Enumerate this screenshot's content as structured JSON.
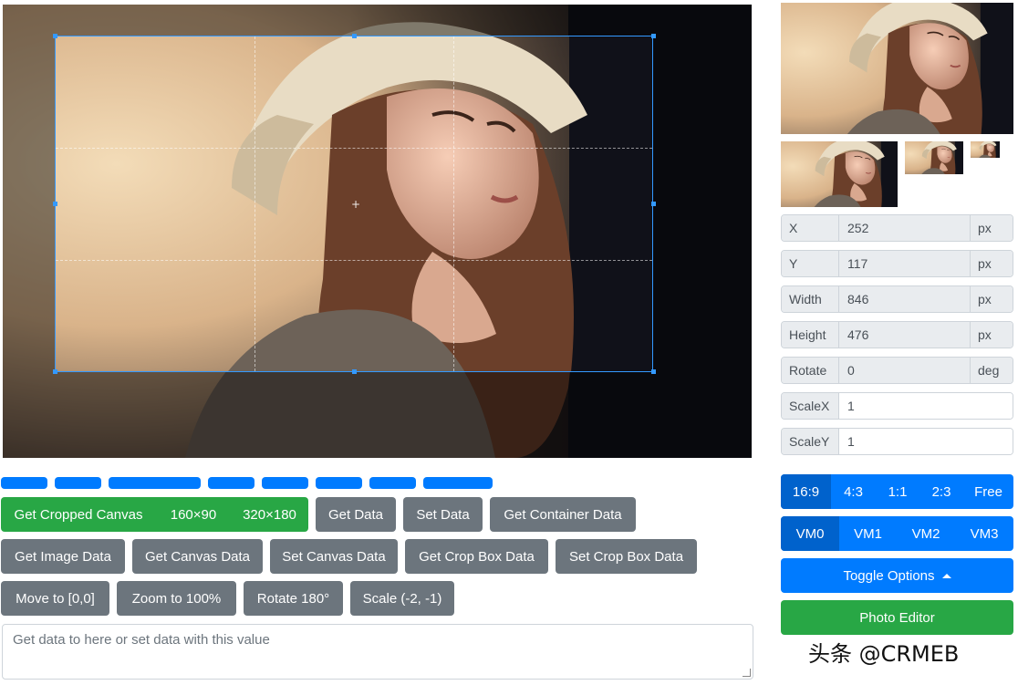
{
  "cropper": {
    "palette": {
      "crop_line": "#3399ff"
    }
  },
  "data_fields": [
    {
      "label": "X",
      "value": "252",
      "unit": "px"
    },
    {
      "label": "Y",
      "value": "117",
      "unit": "px"
    },
    {
      "label": "Width",
      "value": "846",
      "unit": "px"
    },
    {
      "label": "Height",
      "value": "476",
      "unit": "px"
    },
    {
      "label": "Rotate",
      "value": "0",
      "unit": "deg"
    },
    {
      "label": "ScaleX",
      "value": "1",
      "unit": ""
    },
    {
      "label": "ScaleY",
      "value": "1",
      "unit": ""
    }
  ],
  "buttons": {
    "get_cropped_canvas": "Get Cropped Canvas",
    "size_160": "160×90",
    "size_320": "320×180",
    "get_data": "Get Data",
    "set_data": "Set Data",
    "get_container_data": "Get Container Data",
    "get_image_data": "Get Image Data",
    "get_canvas_data": "Get Canvas Data",
    "set_canvas_data": "Set Canvas Data",
    "get_crop_box_data": "Get Crop Box Data",
    "set_crop_box_data": "Set Crop Box Data",
    "move_to": "Move to [0,0]",
    "zoom_to": "Zoom to 100%",
    "rotate_180": "Rotate 180°",
    "scale": "Scale (-2, -1)"
  },
  "textarea": {
    "placeholder": "Get data to here or set data with this value"
  },
  "aspect_ratios": [
    "16:9",
    "4:3",
    "1:1",
    "2:3",
    "Free"
  ],
  "view_modes": [
    "VM0",
    "VM1",
    "VM2",
    "VM3"
  ],
  "toggle_options": "Toggle Options",
  "photo_editor": "Photo Editor",
  "watermark": "头条 @CRMEB",
  "colors": {
    "primary": "#007bff",
    "success": "#28a745",
    "secondary": "#6c757d",
    "active": "#0062cc"
  }
}
